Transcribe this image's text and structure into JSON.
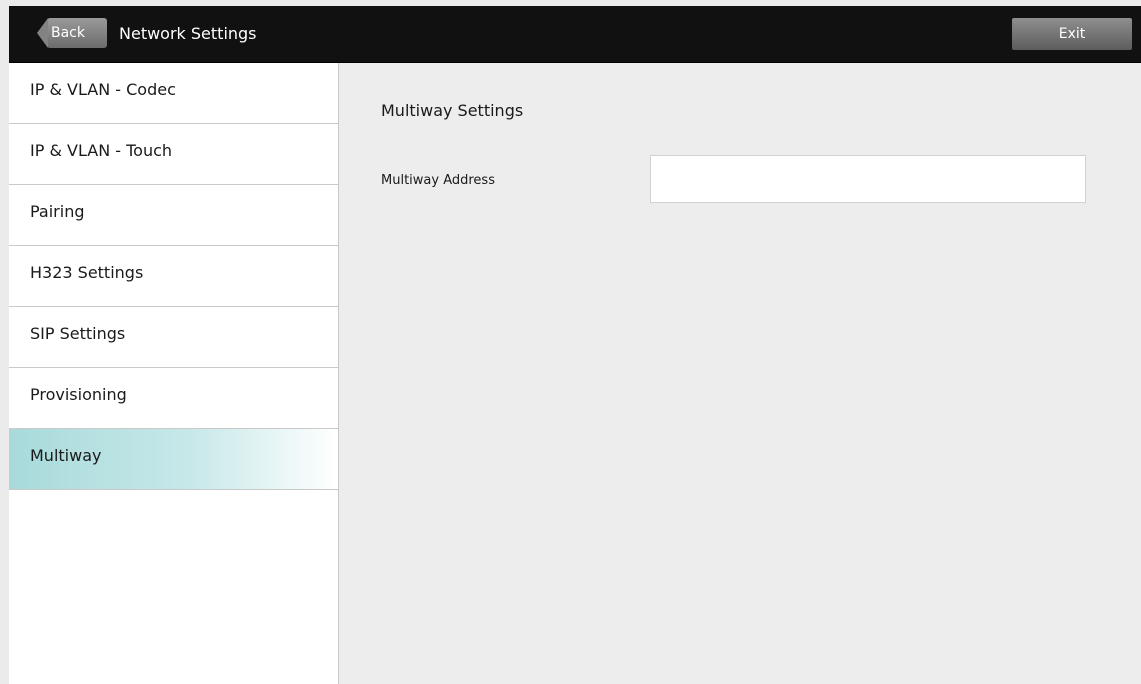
{
  "header": {
    "back_label": "Back",
    "title": "Network Settings",
    "exit_label": "Exit"
  },
  "sidebar": {
    "items": [
      {
        "label": "IP & VLAN - Codec"
      },
      {
        "label": "IP & VLAN - Touch"
      },
      {
        "label": "Pairing"
      },
      {
        "label": "H323 Settings"
      },
      {
        "label": "SIP Settings"
      },
      {
        "label": "Provisioning"
      },
      {
        "label": "Multiway",
        "active": true
      }
    ]
  },
  "main": {
    "section_title": "Multiway Settings",
    "multiway_address": {
      "label": "Multiway Address",
      "value": "",
      "placeholder": ""
    }
  },
  "colors": {
    "topbar": "#111111",
    "active_item": "#a8dadb",
    "background": "#ebebeb"
  }
}
